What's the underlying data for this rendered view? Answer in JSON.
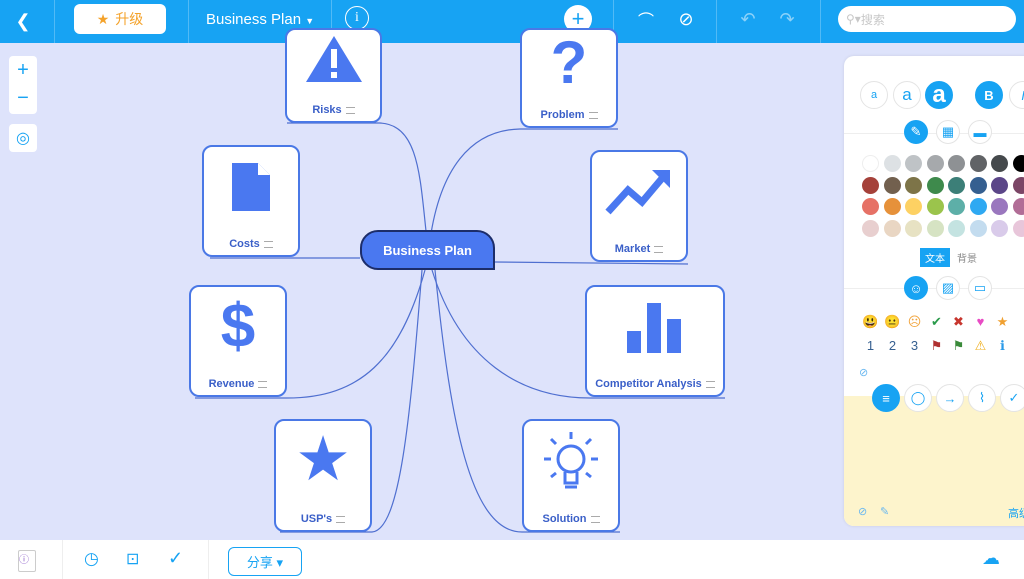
{
  "toolbar": {
    "upgrade_label": "升级",
    "doc_title": "Business Plan",
    "search_placeholder": "搜索",
    "icons": [
      "back-icon",
      "info-icon",
      "add-icon",
      "relationship-icon",
      "clear-icon",
      "undo-icon",
      "redo-icon",
      "search-icon"
    ]
  },
  "canvas": {
    "zoom_in": "+",
    "zoom_out": "−"
  },
  "mindmap": {
    "center": "Business Plan",
    "nodes": [
      {
        "label": "Risks",
        "icon": "warning-icon"
      },
      {
        "label": "Problem",
        "icon": "question-icon"
      },
      {
        "label": "Costs",
        "icon": "document-icon"
      },
      {
        "label": "Market",
        "icon": "trend-up-icon"
      },
      {
        "label": "Revenue",
        "icon": "dollar-icon"
      },
      {
        "label": "Competitor Analysis",
        "icon": "bar-chart-icon"
      },
      {
        "label": "USP's",
        "icon": "star-icon"
      },
      {
        "label": "Solution",
        "icon": "lightbulb-icon"
      }
    ]
  },
  "panel": {
    "font_sizes": [
      "a",
      "a",
      "a"
    ],
    "bold": "B",
    "italic": "I",
    "text_tab": "文本",
    "bg_tab": "背景",
    "advanced": "高级",
    "colors": [
      [
        "#ffffff",
        "#dde1e4",
        "#bfc3c6",
        "#a6a9ac",
        "#8e9194",
        "#616366",
        "#45494c",
        "#000000"
      ],
      [
        "#a5413a",
        "#72604e",
        "#7d7448",
        "#3e8a4c",
        "#3c7f78",
        "#355f90",
        "#5b4688",
        "#7b4666"
      ],
      [
        "#e67166",
        "#e6913a",
        "#fdd163",
        "#9bc44c",
        "#5dafa8",
        "#2fa9f2",
        "#9a77be",
        "#b16d96"
      ],
      [
        "#e8cfcf",
        "#e9d6c3",
        "#e7e2c3",
        "#d6e3c3",
        "#c4e3e1",
        "#c3dcef",
        "#d9cbea",
        "#e8c6da"
      ]
    ],
    "emoji_row1": [
      "😃",
      "😐",
      "☹",
      "✔",
      "✖",
      "♥",
      "★"
    ],
    "emoji_row2": [
      "1",
      "2",
      "3",
      "⚑",
      "⚑",
      "⚠",
      "ℹ"
    ]
  },
  "bottom": {
    "share_label": "分享 ▾"
  }
}
